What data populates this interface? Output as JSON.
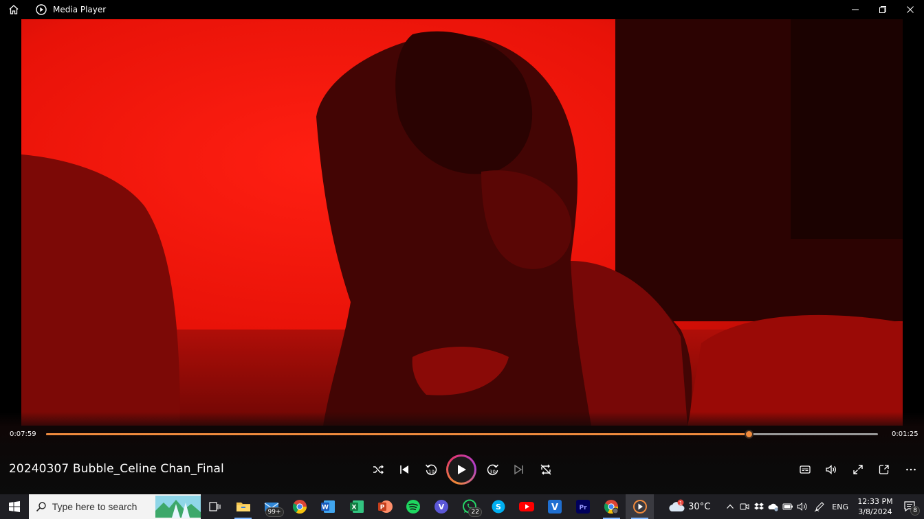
{
  "window": {
    "title": "Media Player",
    "icons": {
      "home": "home-icon",
      "app": "media-player-icon",
      "minimize": "minimize-icon",
      "maximize": "restore-icon",
      "close": "close-icon"
    }
  },
  "playback": {
    "elapsed": "0:07:59",
    "remaining": "0:01:25",
    "progress": 0.845,
    "media_title": "20240307 Bubble_Celine Chan_Final",
    "accent_color": "#ef8a3d"
  },
  "controls": {
    "shuffle": "shuffle-icon",
    "previous": "previous-icon",
    "rewind": "rewind-10-icon",
    "play": "play-icon",
    "forward": "forward-30-icon",
    "next": "next-icon",
    "repeat": "repeat-off-icon",
    "subtitles": "subtitles-icon",
    "volume": "volume-icon",
    "fullscreen": "fullscreen-icon",
    "miniplayer": "miniplayer-icon",
    "more": "more-icon",
    "rewind_label": "10",
    "forward_label": "30"
  },
  "taskbar": {
    "search_placeholder": "Type here to search",
    "apps": [
      {
        "name": "task-view",
        "icon": "task-view-icon"
      },
      {
        "name": "file-explorer",
        "icon": "folder-icon"
      },
      {
        "name": "mail",
        "icon": "mail-icon",
        "badge": "99+"
      },
      {
        "name": "chrome",
        "icon": "chrome-icon"
      },
      {
        "name": "word",
        "icon": "word-icon"
      },
      {
        "name": "excel",
        "icon": "excel-icon"
      },
      {
        "name": "powerpoint",
        "icon": "powerpoint-icon"
      },
      {
        "name": "spotify",
        "icon": "spotify-icon"
      },
      {
        "name": "viber",
        "icon": "viber-icon"
      },
      {
        "name": "whatsapp",
        "icon": "whatsapp-icon",
        "badge": "22"
      },
      {
        "name": "skype",
        "icon": "skype-icon"
      },
      {
        "name": "youtube",
        "icon": "youtube-icon"
      },
      {
        "name": "vimeo",
        "icon": "vimeo-icon"
      },
      {
        "name": "premiere",
        "icon": "premiere-icon"
      },
      {
        "name": "chrome-profile",
        "icon": "chrome-icon"
      },
      {
        "name": "media-player",
        "icon": "media-player-icon"
      }
    ],
    "weather": {
      "temp": "30°C",
      "alert": "1"
    },
    "language": "ENG",
    "time": "12:33 PM",
    "date": "3/8/2024",
    "notifications": "8",
    "labels": {
      "word": "W",
      "excel": "X",
      "powerpoint": "P",
      "viber": "V",
      "skype": "S",
      "vimeo": "V",
      "premiere": "Pr"
    }
  }
}
